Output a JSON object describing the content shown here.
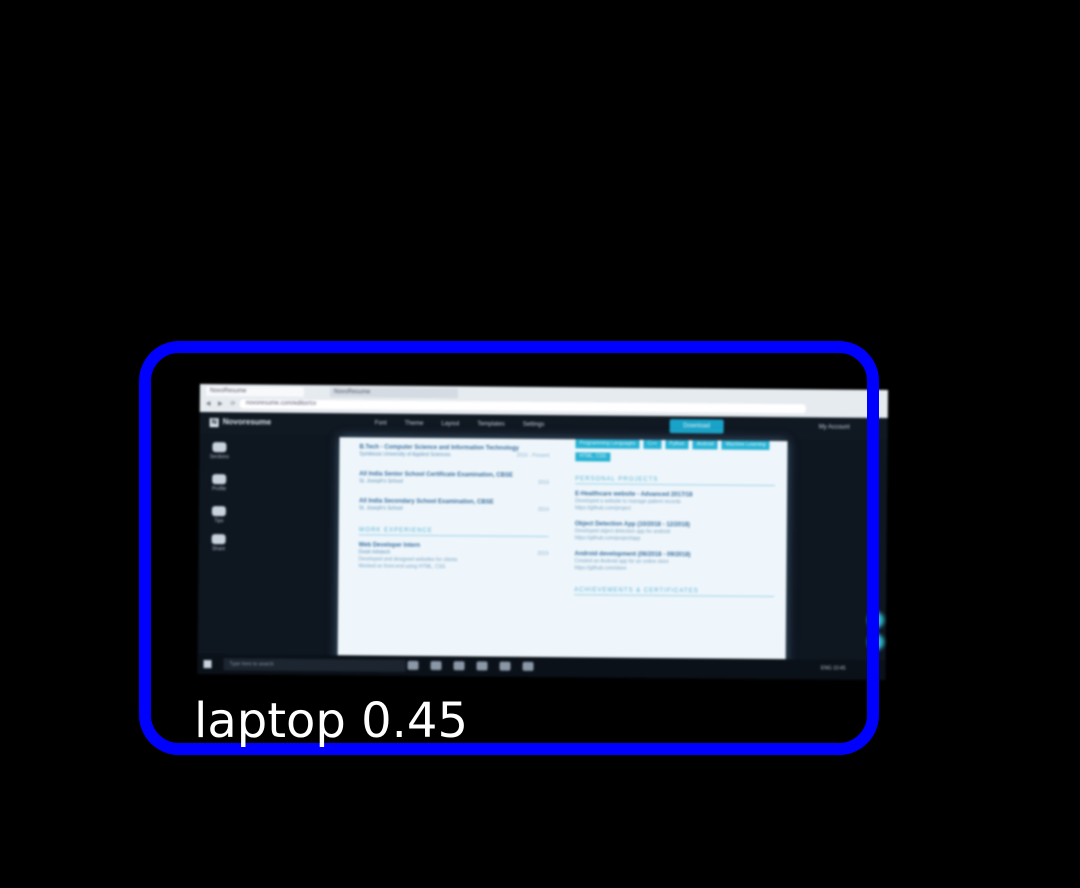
{
  "detection": {
    "label": "laptop 0.45",
    "color": "#0000ff"
  },
  "browser": {
    "tabs": [
      "NovoResume",
      "NovoResume"
    ],
    "address": "novoresume.com/editor/cv"
  },
  "app": {
    "logo_mark": "N",
    "logo_text": "Novoresume",
    "menu": [
      "Font",
      "Theme",
      "Layout",
      "Templates",
      "Settings"
    ],
    "download_label": "Download",
    "account_label": "My Account",
    "sidebar": [
      {
        "label": "Sections",
        "icon": "sections-icon"
      },
      {
        "label": "Profile",
        "icon": "profile-icon"
      },
      {
        "label": "Tips",
        "icon": "tips-icon"
      },
      {
        "label": "Share",
        "icon": "share-icon"
      }
    ]
  },
  "resume": {
    "left": {
      "education": [
        {
          "title": "B.Tech - Computer Science and Information Technology",
          "sub": "Symbiosis University of Applied Sciences",
          "date": "2016 - Present"
        },
        {
          "title": "All India Senior School Certificate Examination, CBSE",
          "sub": "St. Joseph's School",
          "date": "2016"
        },
        {
          "title": "All India Secondary School Examination, CBSE",
          "sub": "St. Joseph's School",
          "date": "2014"
        }
      ],
      "work_head": "WORK EXPERIENCE",
      "work": {
        "title": "Web Developer Intern",
        "sub": "Dvish Infotech",
        "date": "2019",
        "bullets": [
          "Developed and designed websites for clients",
          "Worked on front-end using HTML, CSS"
        ]
      }
    },
    "right": {
      "chips": [
        "Programming Languages",
        "C++",
        "Python",
        "Android",
        "Machine Learning",
        "HTML, CSS"
      ],
      "projects_head": "PERSONAL PROJECTS",
      "projects": [
        {
          "title": "E-Healthcare website - Advanced 2017/18",
          "bullets": [
            "Developed a website to manage patient records",
            "https://github.com/project"
          ]
        },
        {
          "title": "Object Detection App (10/2018 - 12/2018)",
          "bullets": [
            "Developed object detection app for android",
            "https://github.com/project/app"
          ]
        },
        {
          "title": "Android development (06/2018 - 09/2018)",
          "bullets": [
            "Created an Android app for an online store",
            "https://github.com/store"
          ]
        }
      ],
      "achievements_head": "ACHIEVEMENTS & CERTIFICATES"
    }
  },
  "taskbar": {
    "search_placeholder": "Type here to search",
    "tray_text": "ENG 10:45"
  },
  "colors": {
    "background": "#000000",
    "accent": "#1aa3c8",
    "page": "#eef6fb"
  }
}
